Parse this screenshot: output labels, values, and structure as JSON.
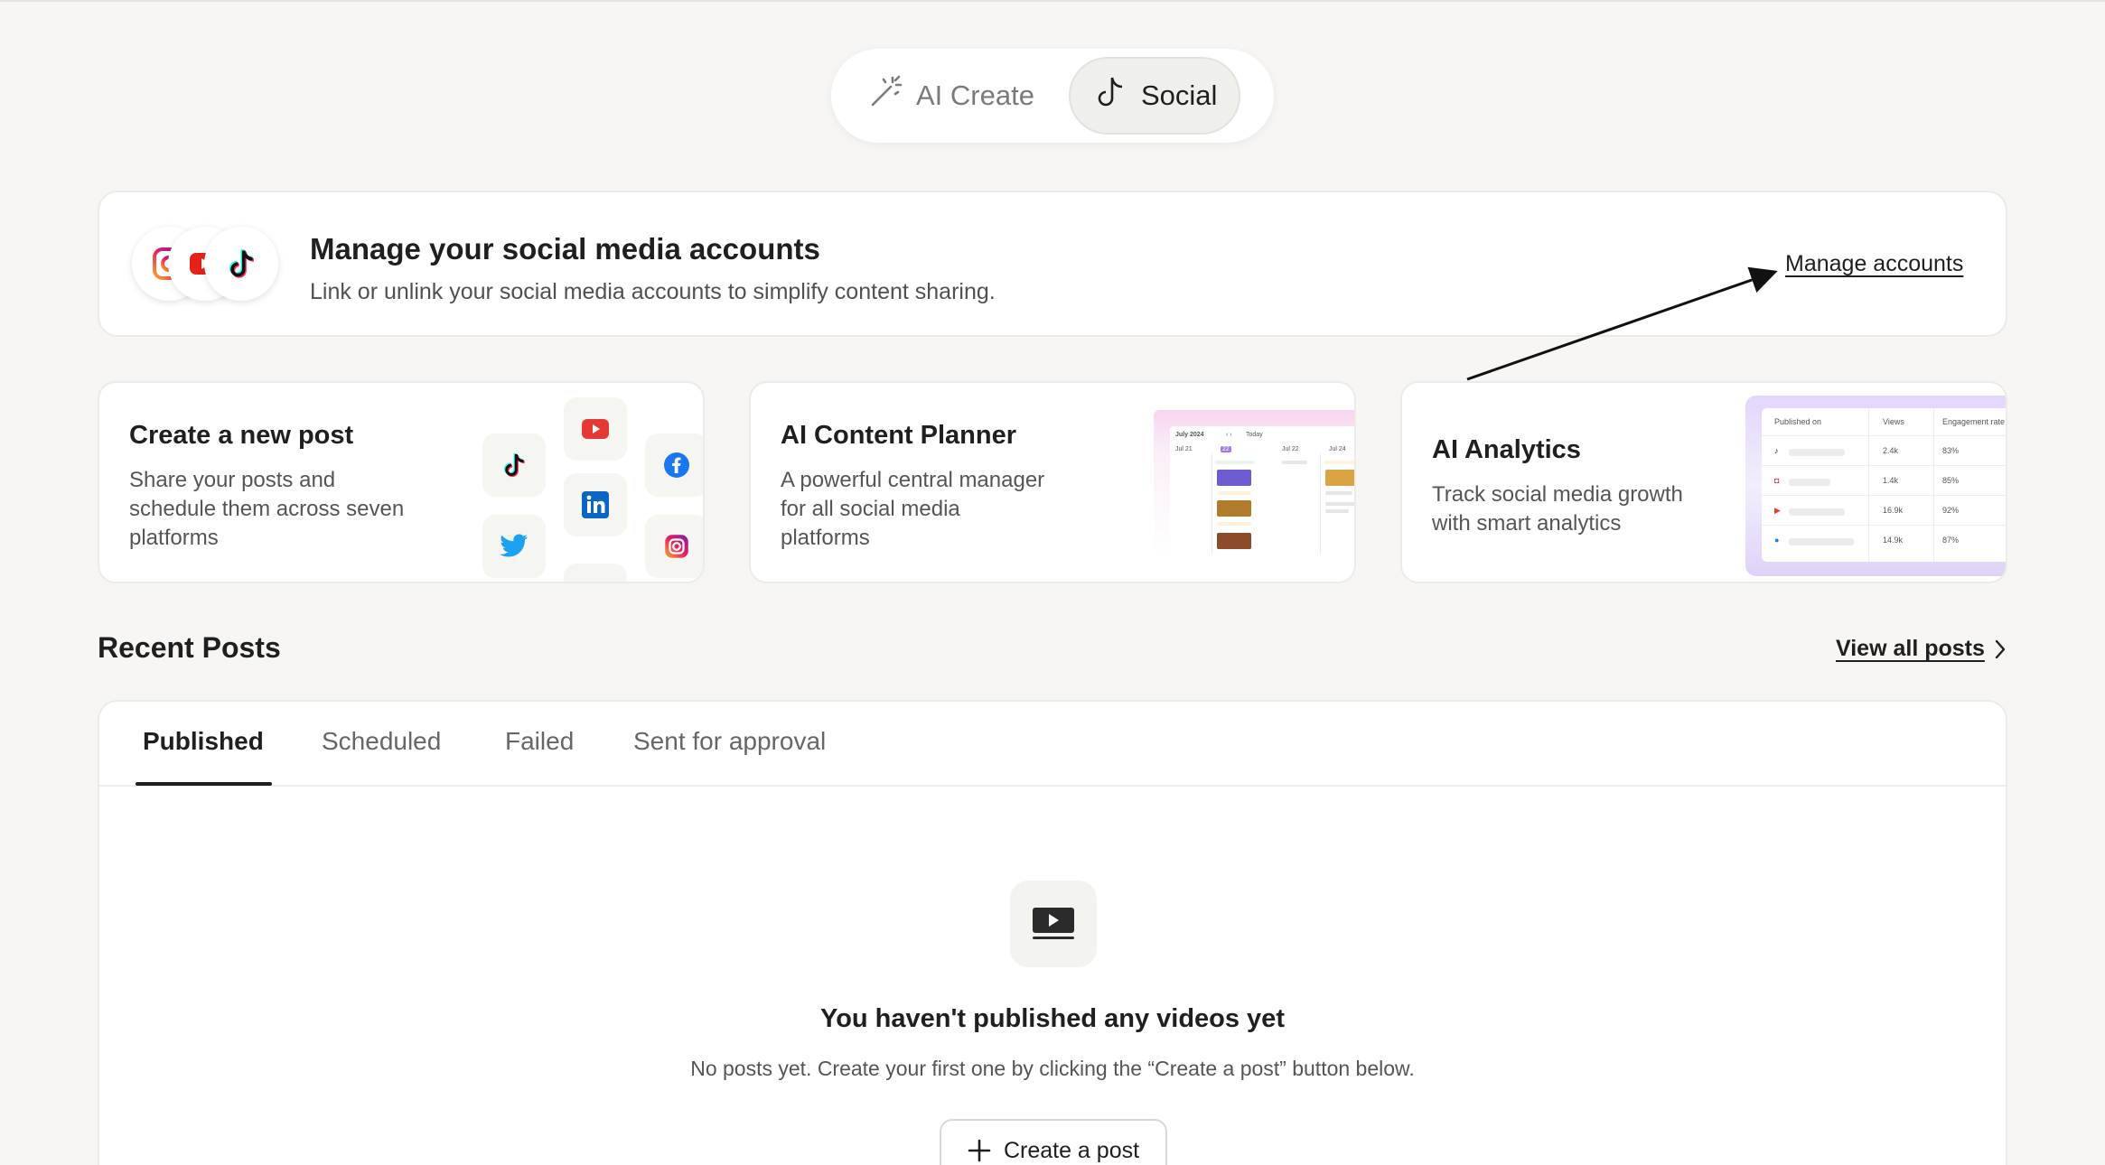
{
  "mode_switch": {
    "ai_create_label": "AI Create",
    "social_label": "Social"
  },
  "banner": {
    "title": "Manage your social media accounts",
    "subtitle": "Link or unlink your social media accounts to simplify content sharing.",
    "manage_link": "Manage accounts"
  },
  "cards": {
    "create_post": {
      "title": "Create a new post",
      "desc_lines": [
        "Share your posts and",
        "schedule them across seven",
        "platforms"
      ]
    },
    "planner": {
      "title": "AI Content Planner",
      "desc_lines": [
        "A powerful central manager",
        "for all social media",
        "platforms"
      ],
      "mock": {
        "month": "July 2024",
        "today": "Today",
        "day1": "Jul 21",
        "day2": "Jul 22",
        "day3": "Jul 24"
      }
    },
    "analytics": {
      "title": "AI Analytics",
      "desc_lines": [
        "Track social media growth",
        "with smart analytics"
      ],
      "table": {
        "headers": [
          "Published on",
          "Views",
          "Engagement rate"
        ],
        "rows": [
          {
            "views": "2.4k",
            "rate": "83%"
          },
          {
            "views": "1.4k",
            "rate": "85%"
          },
          {
            "views": "16.9k",
            "rate": "92%"
          },
          {
            "views": "14.9k",
            "rate": "87%"
          }
        ]
      }
    }
  },
  "recent": {
    "title": "Recent Posts",
    "view_all": "View all posts",
    "tabs": [
      "Published",
      "Scheduled",
      "Failed",
      "Sent for approval"
    ],
    "empty_title": "You haven't published any videos yet",
    "empty_sub": "No posts yet. Create your first one by clicking the “Create a post” button below.",
    "create_button": "Create a post"
  }
}
